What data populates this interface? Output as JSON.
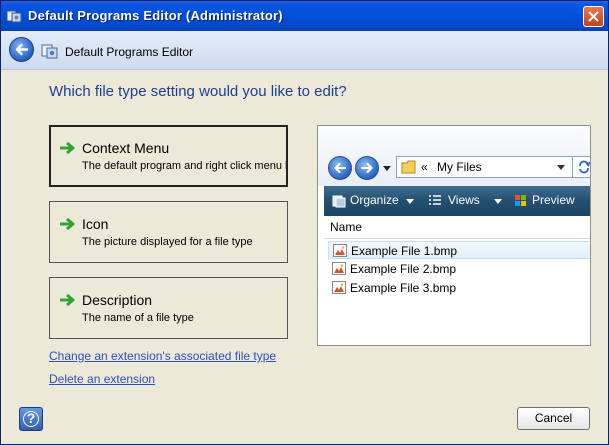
{
  "window": {
    "title": "Default Programs Editor (Administrator)",
    "close_icon": "close-icon"
  },
  "nav": {
    "title": "Default Programs Editor"
  },
  "main": {
    "question": "Which file type setting would you like to edit?",
    "options": [
      {
        "title": "Context Menu",
        "description": "The default program and right click menu list",
        "selected": true
      },
      {
        "title": "Icon",
        "description": "The picture displayed for a file type",
        "selected": false
      },
      {
        "title": "Description",
        "description": "The name of a file type",
        "selected": false
      }
    ],
    "links": [
      "Change an extension's associated file type",
      "Delete an extension"
    ]
  },
  "preview": {
    "address_separator": "«",
    "address_text": "My Files",
    "toolbar": {
      "organize": "Organize",
      "views": "Views",
      "preview": "Preview"
    },
    "column_name": "Name",
    "files": [
      "Example File 1.bmp",
      "Example File 2.bmp",
      "Example File 3.bmp"
    ]
  },
  "footer": {
    "help_label": "?",
    "cancel_label": "Cancel"
  },
  "colors": {
    "titlebar": "#0150d6",
    "question_text": "#1c3e95",
    "link": "#2d4fbf",
    "arrow_green": "#2fa52f",
    "preview_toolbar": "#24506f"
  }
}
